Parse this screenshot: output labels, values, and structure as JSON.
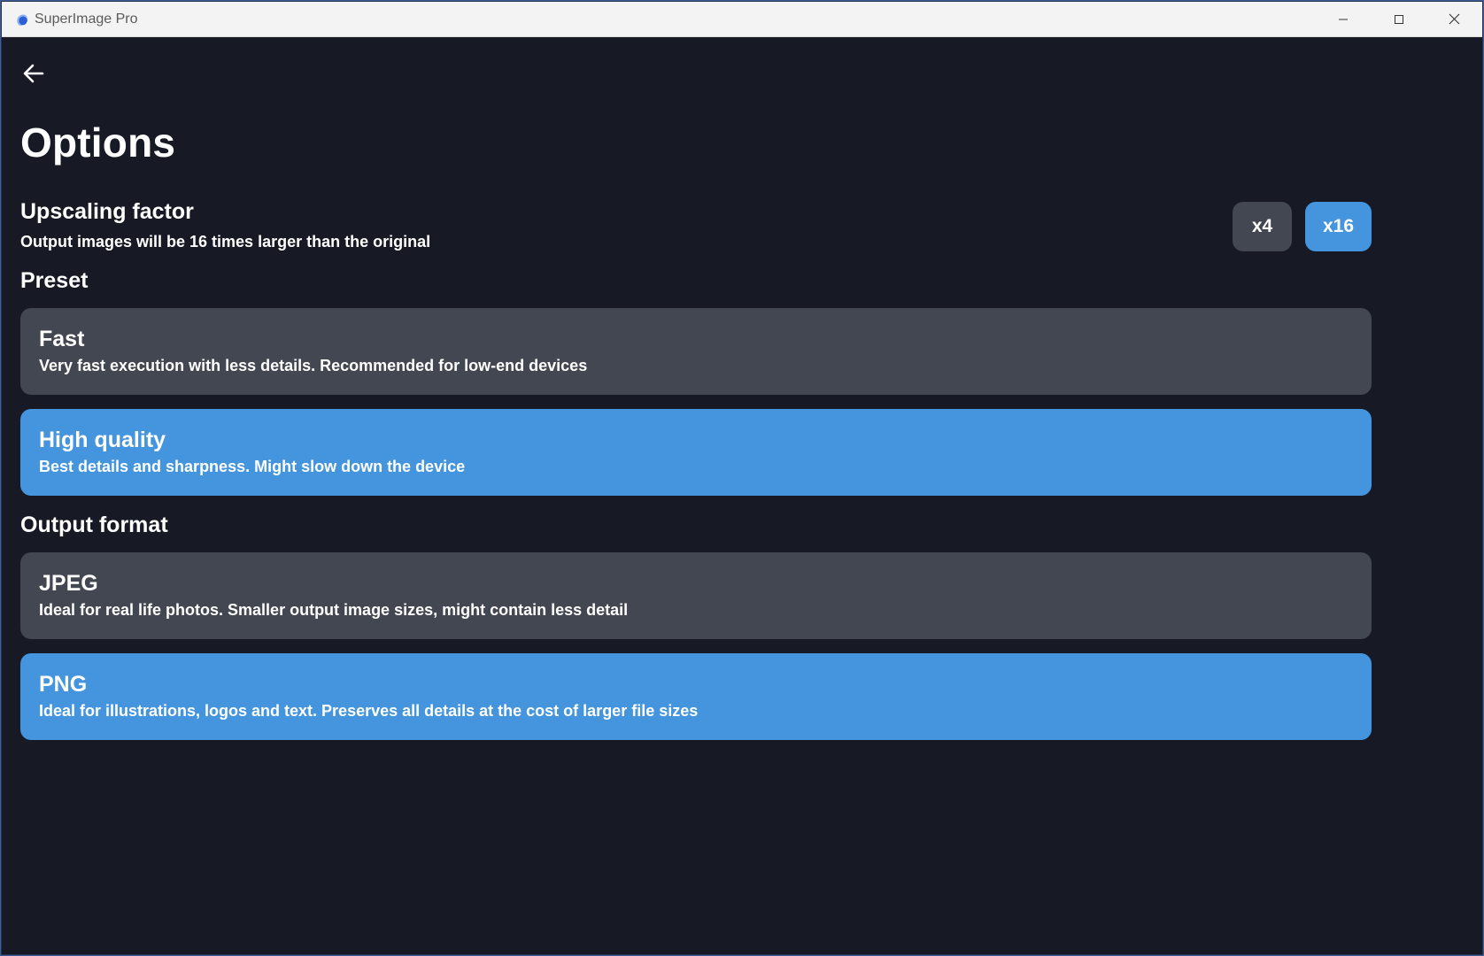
{
  "window": {
    "title": "SuperImage Pro",
    "controls": [
      "minimize-icon",
      "maximize-icon",
      "close-icon"
    ]
  },
  "page": {
    "back_icon": "arrow-left-icon",
    "title": "Options"
  },
  "upscaling": {
    "heading": "Upscaling factor",
    "description": "Output images will be 16 times larger than the original",
    "options": [
      {
        "label": "x4",
        "selected": false
      },
      {
        "label": "x16",
        "selected": true
      }
    ]
  },
  "preset": {
    "heading": "Preset",
    "options": [
      {
        "title": "Fast",
        "description": "Very fast execution with less details. Recommended for low-end devices",
        "selected": false
      },
      {
        "title": "High quality",
        "description": "Best details and sharpness. Might slow down the device",
        "selected": true
      }
    ]
  },
  "output_format": {
    "heading": "Output format",
    "options": [
      {
        "title": "JPEG",
        "description": "Ideal for real life photos. Smaller output image sizes, might contain less detail",
        "selected": false
      },
      {
        "title": "PNG",
        "description": "Ideal for illustrations, logos and text. Preserves all details at the cost of larger file sizes",
        "selected": true
      }
    ]
  },
  "colors": {
    "background": "#171a25",
    "selected": "#4495dd",
    "unselected": "#434751",
    "text": "#ffffff"
  }
}
